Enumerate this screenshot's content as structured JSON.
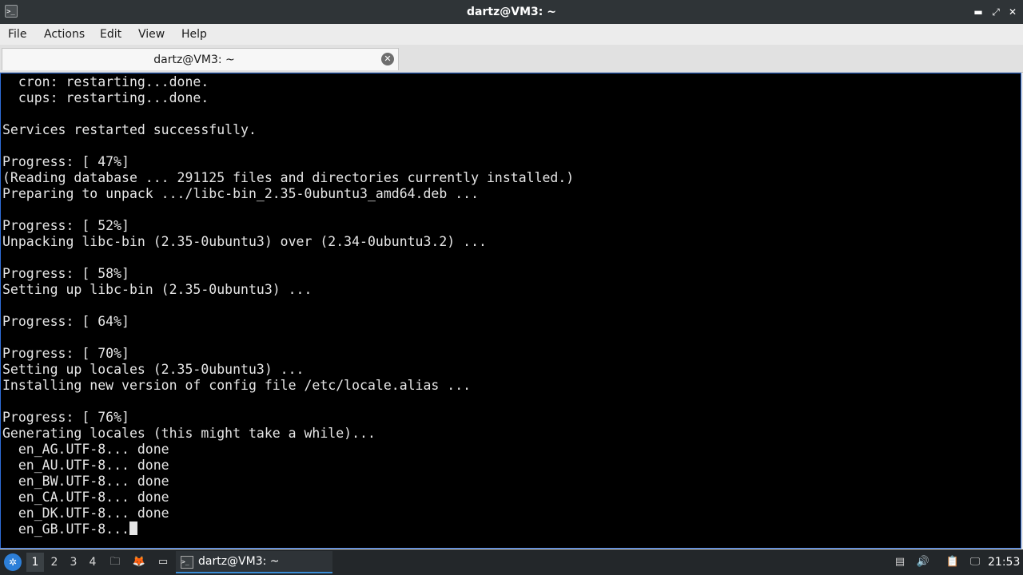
{
  "window": {
    "title": "dartz@VM3: ~",
    "app_icon": "terminal-icon",
    "app_icon_glyph": ">_",
    "minimize_glyph": "▬",
    "maximize_glyph": "⤢",
    "close_glyph": "✕"
  },
  "menu": {
    "items": [
      "File",
      "Actions",
      "Edit",
      "View",
      "Help"
    ]
  },
  "tabs": [
    {
      "label": "dartz@VM3: ~",
      "close_glyph": "✕"
    }
  ],
  "terminal": {
    "lines": [
      "  cron: restarting...done.",
      "  cups: restarting...done.",
      "",
      "Services restarted successfully.",
      "",
      "Progress: [ 47%]",
      "(Reading database ... 291125 files and directories currently installed.)",
      "Preparing to unpack .../libc-bin_2.35-0ubuntu3_amd64.deb ...",
      "",
      "Progress: [ 52%]",
      "Unpacking libc-bin (2.35-0ubuntu3) over (2.34-0ubuntu3.2) ...",
      "",
      "Progress: [ 58%]",
      "Setting up libc-bin (2.35-0ubuntu3) ...",
      "",
      "Progress: [ 64%]",
      "",
      "Progress: [ 70%]",
      "Setting up locales (2.35-0ubuntu3) ...",
      "Installing new version of config file /etc/locale.alias ...",
      "",
      "Progress: [ 76%]",
      "Generating locales (this might take a while)...",
      "  en_AG.UTF-8... done",
      "  en_AU.UTF-8... done",
      "  en_BW.UTF-8... done",
      "  en_CA.UTF-8... done",
      "  en_DK.UTF-8... done"
    ],
    "current_line": "  en_GB.UTF-8...",
    "colors": {
      "background": "#000000",
      "foreground": "#e6e6e6"
    }
  },
  "taskbar": {
    "start_icon": "start-menu-icon",
    "start_glyph": "✲",
    "workspaces": [
      "1",
      "2",
      "3",
      "4"
    ],
    "active_workspace": "1",
    "launchers": [
      {
        "name": "file-manager-icon",
        "glyph": "🗀"
      },
      {
        "name": "firefox-icon",
        "glyph": "🦊"
      },
      {
        "name": "show-desktop-icon",
        "glyph": "▭"
      }
    ],
    "task": {
      "label": "dartz@VM3: ~",
      "icon_glyph": ">_"
    },
    "tray": [
      {
        "name": "notes-icon",
        "glyph": "▤"
      },
      {
        "name": "volume-icon",
        "glyph": "🔊"
      },
      {
        "name": "clipboard-icon",
        "glyph": "📋"
      },
      {
        "name": "network-icon",
        "glyph": "🖵"
      }
    ],
    "clock": "21:53"
  }
}
